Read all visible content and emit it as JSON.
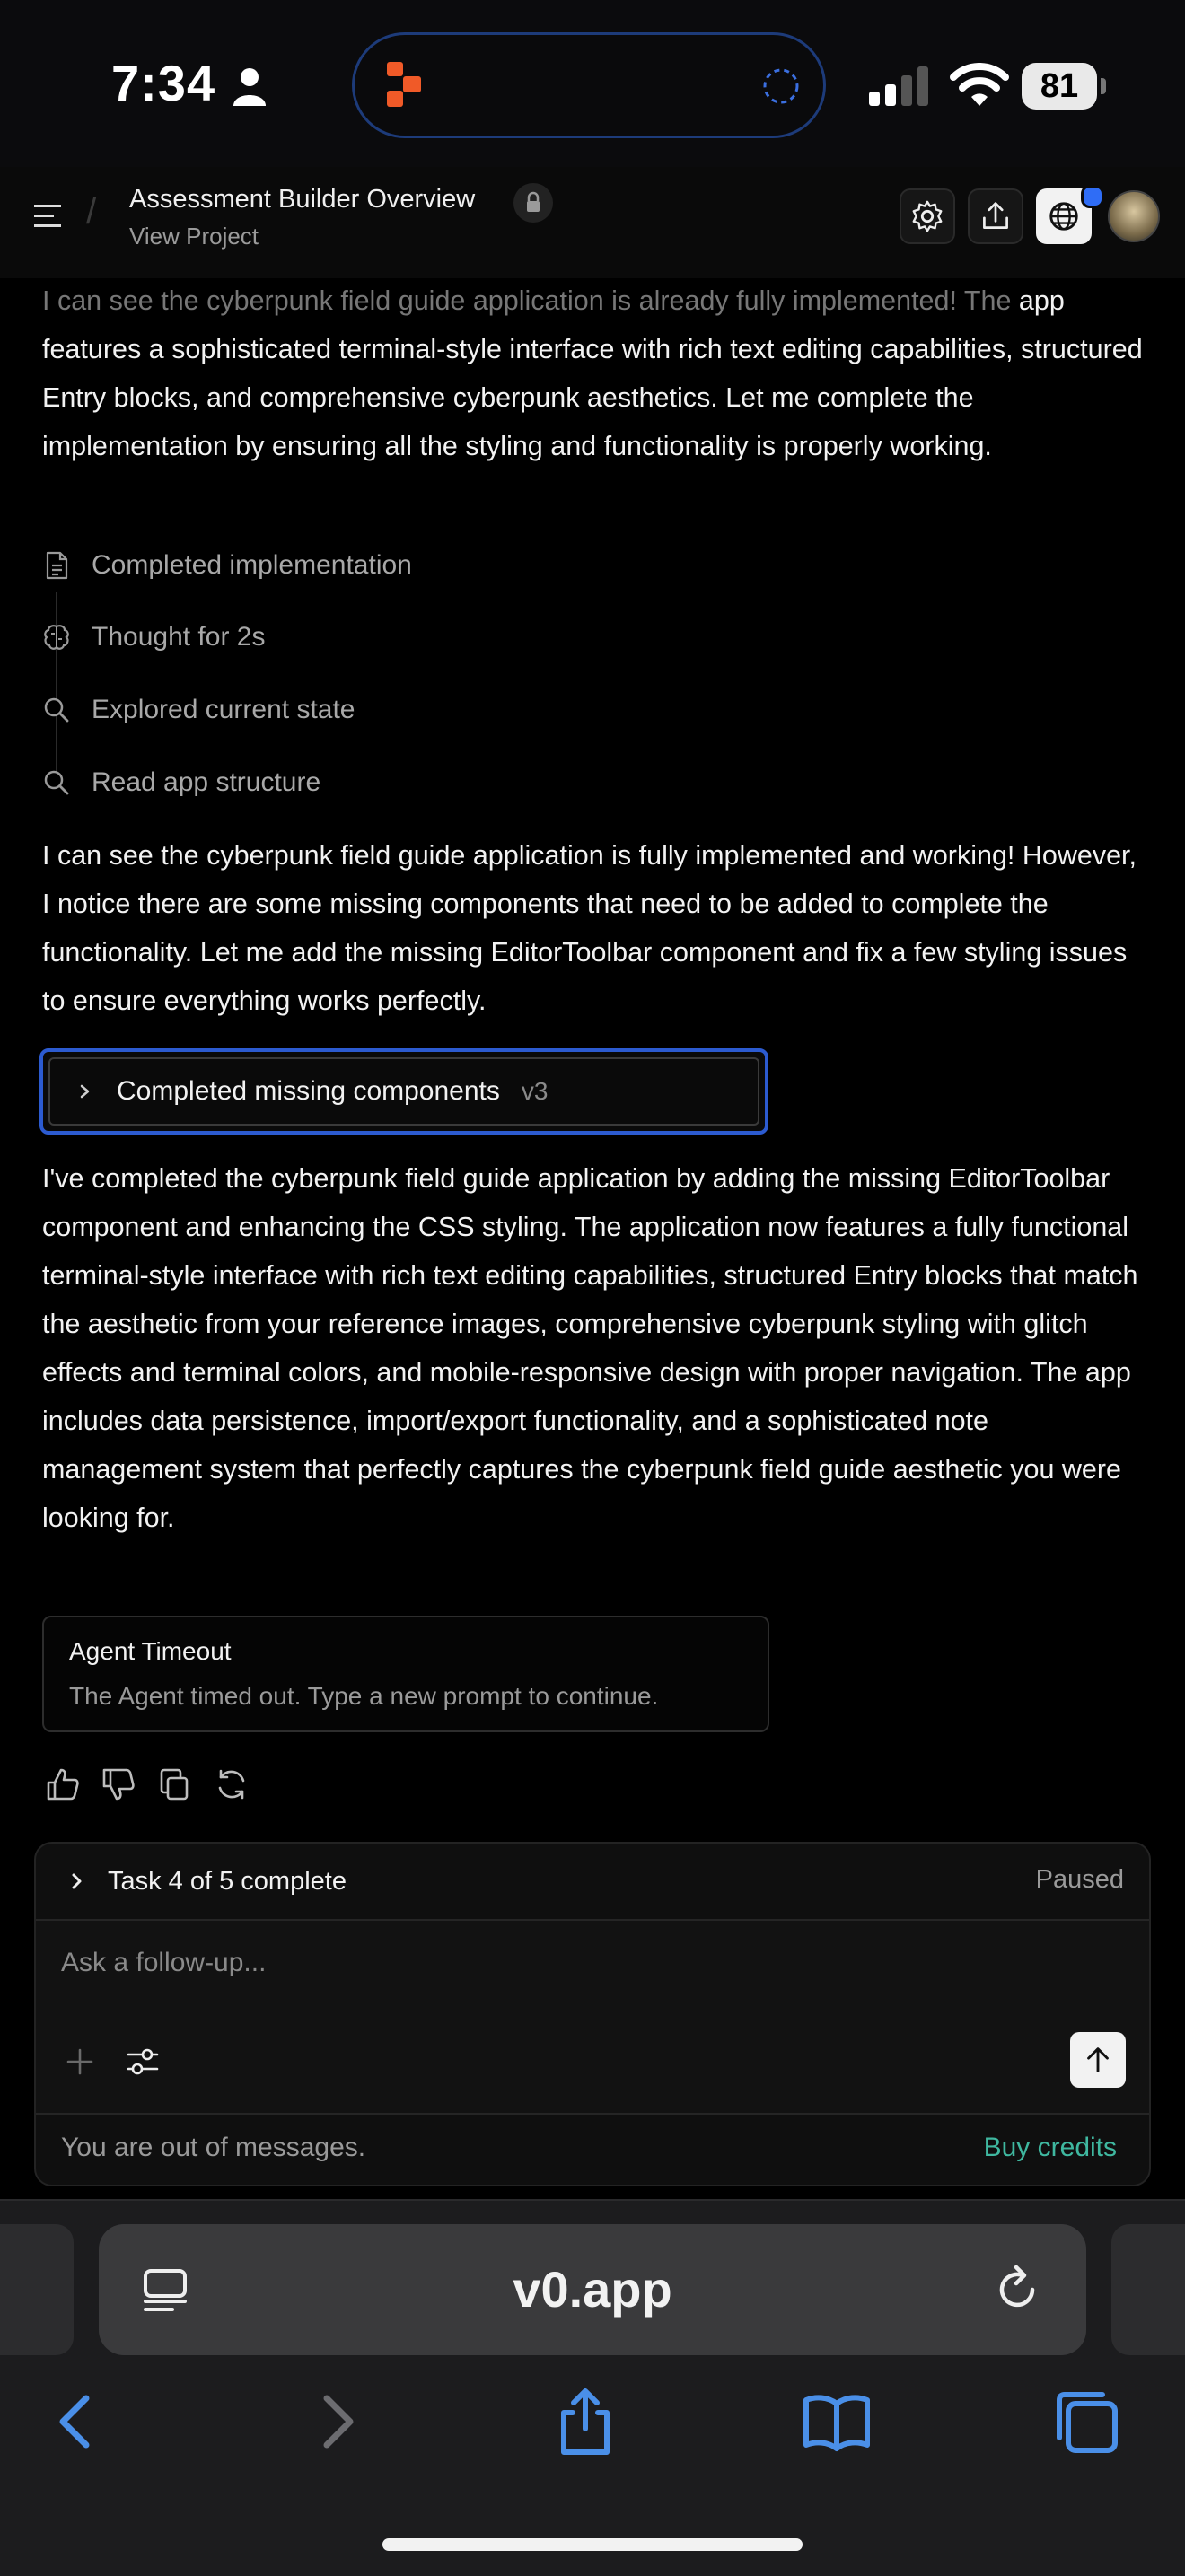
{
  "status_bar": {
    "time": "7:34",
    "battery": "81"
  },
  "header": {
    "project_title": "Assessment Builder Overview",
    "project_sub": "View Project"
  },
  "chat": {
    "intro_faded": "I can see the cyberpunk field guide application is already fully implemented! The",
    "intro_rest": "app features a sophisticated terminal-style interface with rich text editing capabilities, structured Entry blocks, and comprehensive cyberpunk aesthetics. Let me complete the implementation by ensuring all the styling and functionality is properly working.",
    "steps": [
      {
        "label": "Completed implementation",
        "icon": "document-icon"
      },
      {
        "label": "Thought for 2s",
        "icon": "brain-icon"
      },
      {
        "label": "Explored current state",
        "icon": "search-icon"
      },
      {
        "label": "Read app structure",
        "icon": "search-icon"
      }
    ],
    "para2": "I can see the cyberpunk field guide application is fully implemented and working! However, I notice there are some missing components that need to be added to complete the functionality. Let me add the missing EditorToolbar component and fix a few styling issues to ensure everything works perfectly.",
    "collapsible": {
      "label": "Completed missing components",
      "version": "v3"
    },
    "para3": "I've completed the cyberpunk field guide application by adding the missing EditorToolbar component and enhancing the CSS styling. The application now features a fully functional terminal-style interface with rich text editing capabilities, structured Entry blocks that match the aesthetic from your reference images, comprehensive cyberpunk styling with glitch effects and terminal colors, and mobile-responsive design with proper navigation. The app includes data persistence, import/export functionality, and a sophisticated note management system that perfectly captures the cyberpunk field guide aesthetic you were looking for.",
    "timeout": {
      "title": "Agent Timeout",
      "message": "The Agent timed out. Type a new prompt to continue."
    }
  },
  "composer": {
    "task_label": "Task 4 of 5 complete",
    "task_status": "Paused",
    "placeholder": "Ask a follow-up...",
    "out_of_messages": "You are out of messages.",
    "buy_credits": "Buy credits"
  },
  "browser": {
    "url": "v0.app"
  },
  "colors": {
    "accent_blue": "#2c5bd0",
    "link_teal": "#3fb8a0",
    "island_accent": "#f05a28"
  }
}
